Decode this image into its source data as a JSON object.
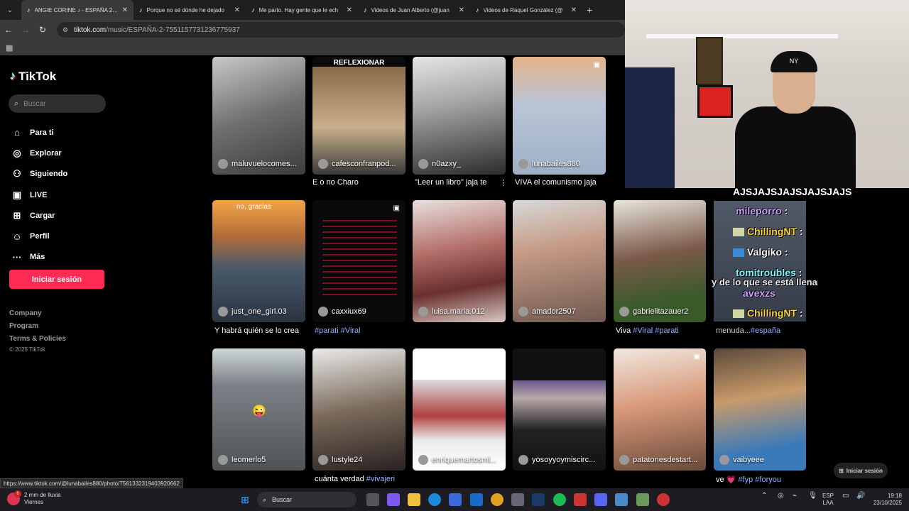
{
  "browser": {
    "tabs": [
      {
        "title": "ANGIE CORINE ♪ - ESPAÑA 2 | T",
        "active": true
      },
      {
        "title": "Porque no sé dónde he dejado",
        "active": false
      },
      {
        "title": "Me parto. Hay gente que le ech",
        "active": false
      },
      {
        "title": "Videos de Juan Alberto (@juan",
        "active": false
      },
      {
        "title": "Videos de Raquel González (@",
        "active": false
      }
    ],
    "url_host": "tiktok.com",
    "url_path": "/music/ESPAÑA-2-7551157731236775937"
  },
  "sidebar": {
    "logo": "TikTok",
    "search_placeholder": "Buscar",
    "nav": [
      {
        "label": "Para ti",
        "icon": "home-icon"
      },
      {
        "label": "Explorar",
        "icon": "compass-icon"
      },
      {
        "label": "Siguiendo",
        "icon": "following-icon"
      },
      {
        "label": "LIVE",
        "icon": "live-icon"
      },
      {
        "label": "Cargar",
        "icon": "upload-icon"
      },
      {
        "label": "Perfil",
        "icon": "profile-icon"
      },
      {
        "label": "Más",
        "icon": "more-icon"
      }
    ],
    "login_label": "Iniciar sesión",
    "footer": [
      "Company",
      "Program",
      "Terms & Policies"
    ],
    "copyright": "© 2025 TikTok"
  },
  "videos": [
    {
      "user": "maluvuelocomes...",
      "caption": "",
      "caption_tag": ""
    },
    {
      "user": "cafesconfranpod...",
      "caption": "E o no Charo",
      "caption_tag": "",
      "overlay": "REFLEXIONAR"
    },
    {
      "user": "n0azxy_",
      "caption": "\"Leer un libro\" jaja te",
      "caption_tag": ""
    },
    {
      "user": "lunabailes880",
      "caption": "VIVA el comunismo jaja",
      "caption_tag": ""
    },
    {
      "user": "just_one_girl.03",
      "caption": "Y habrá quién se lo crea",
      "caption_tag": "",
      "overlay": "no, gracias"
    },
    {
      "user": "caxxiux69",
      "caption": "",
      "caption_tag": "#parati #Viral"
    },
    {
      "user": "luisa.maria.012",
      "caption": "",
      "caption_tag": ""
    },
    {
      "user": "amador2507",
      "caption": "",
      "caption_tag": ""
    },
    {
      "user": "gabrielitazauer2",
      "caption": "Viva ",
      "caption_tag": "#Viral #parati"
    },
    {
      "user": "",
      "caption": "menuda...",
      "caption_tag": "#españa"
    },
    {
      "user": "leomerlo5",
      "caption": "",
      "caption_tag": ""
    },
    {
      "user": "lustyle24",
      "caption": "cuánta verdad ",
      "caption_tag": "#vivajeri"
    },
    {
      "user": "enriquemartosml...",
      "caption": "",
      "caption_tag": ""
    },
    {
      "user": "yosoyyoymiscirc...",
      "caption": "",
      "caption_tag": ""
    },
    {
      "user": "patatonesdestart...",
      "caption": "",
      "caption_tag": ""
    },
    {
      "user": "vaibyeee",
      "caption": "ve 💗 ",
      "caption_tag": "#fyp #foryou"
    }
  ],
  "stream": {
    "chat_header": "AJSJAJSJAJSJAJSJAJS",
    "chat": [
      {
        "name": "mileporro",
        "color": "#c9a0ff"
      },
      {
        "name": "ChillingNT",
        "color": "#ffd43b"
      },
      {
        "name": "Valgiko",
        "color": "#ffffff"
      },
      {
        "name": "tomitroubles",
        "color": "#7ff3ff"
      },
      {
        "name": "avexzs",
        "color": "#c9a0ff"
      },
      {
        "name": "ChillingNT",
        "color": "#ffd43b"
      }
    ],
    "chat_overlay": "y de lo que se está llenando España",
    "cap_text": "NY"
  },
  "iniciar_sesion_float": "Iniciar sesión",
  "status_url": "https://www.tiktok.com/@lunabailes880/photo/7561332319403920662",
  "taskbar": {
    "weather_line1": "2 mm de lluvia",
    "weather_line2": "Viernes",
    "weather_badge": "6",
    "search": "Buscar",
    "lang1": "ESP",
    "lang2": "LAA",
    "time": "19:18",
    "date": "23/10/2025"
  },
  "colors": {
    "accent": "#fe2c55",
    "hashtag": "#8fb3ff"
  }
}
